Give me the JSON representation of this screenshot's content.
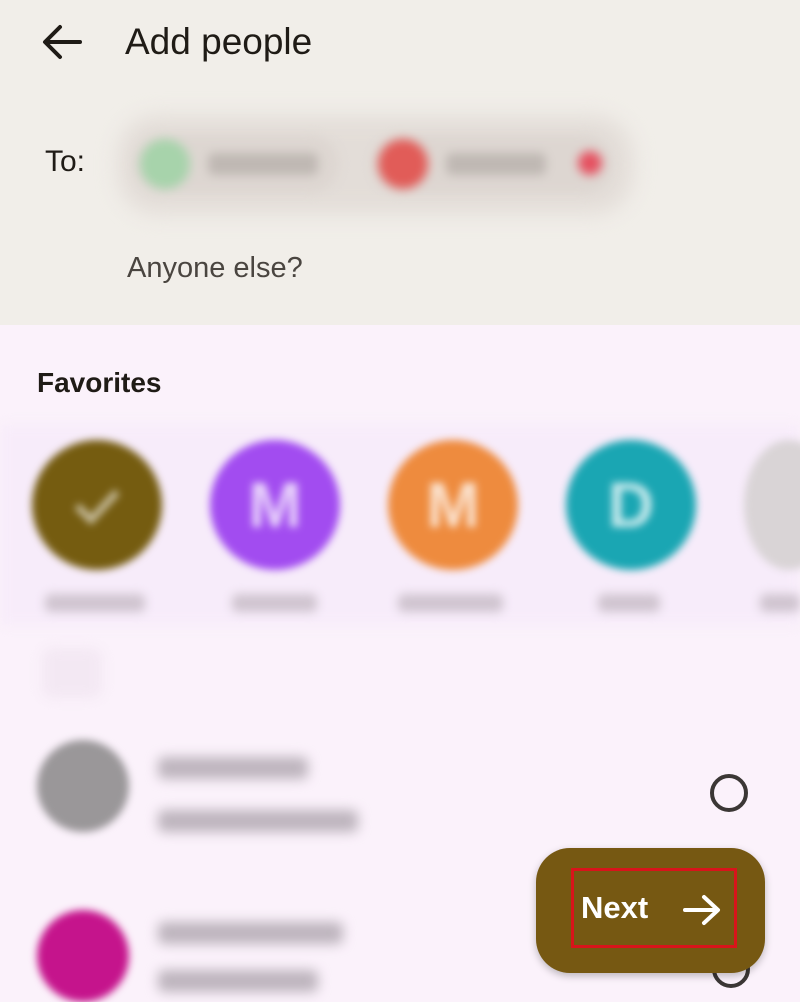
{
  "header": {
    "title": "Add people",
    "back_icon": "arrow-left-icon"
  },
  "recipients": {
    "to_label": "To:",
    "prompt": "Anyone else?"
  },
  "favorites": {
    "heading": "Favorites",
    "items": [
      {
        "initial": "",
        "color": "#755c10"
      },
      {
        "initial": "M",
        "color": "#a24cf0"
      },
      {
        "initial": "M",
        "color": "#ee8b3e"
      },
      {
        "initial": "D",
        "color": "#1aa6b3"
      }
    ]
  },
  "contacts": {
    "rows": [
      {
        "avatar_color": "#8d8a8c"
      },
      {
        "avatar_color": "#c5148c"
      }
    ]
  },
  "actions": {
    "next_label": "Next",
    "next_icon": "arrow-right-icon"
  },
  "colors": {
    "accent": "#765812",
    "highlight": "#d8141b"
  }
}
